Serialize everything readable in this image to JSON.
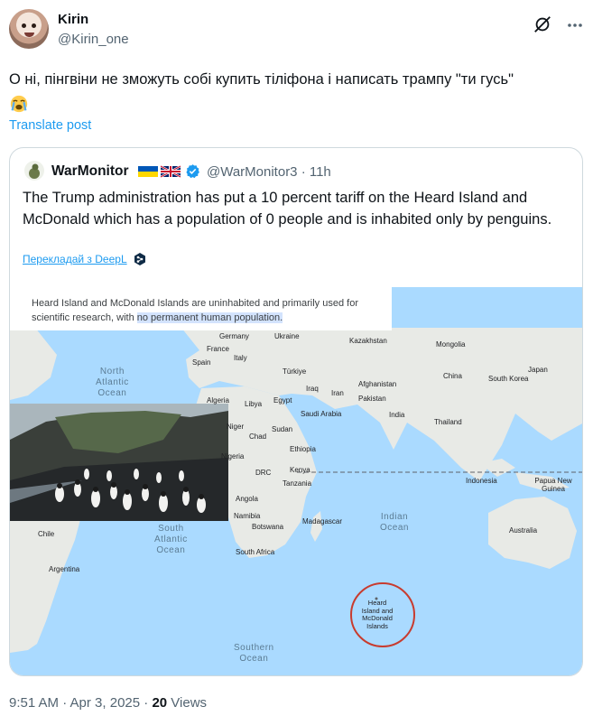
{
  "author": {
    "display_name": "Kirin",
    "handle": "@Kirin_one"
  },
  "post": {
    "text": "О ні, пінгвіни не зможуть собі купить тіліфона і написать трампу \"ти гусь\"",
    "emoji_icon": "loudly-crying-face-icon",
    "translate_label": "Translate post"
  },
  "quoted": {
    "display_name": "WarMonitor",
    "flags": [
      "ukraine-flag-icon",
      "uk-flag-icon"
    ],
    "handle": "@WarMonitor3",
    "time": "· 11h",
    "text": "The Trump administration has put a 10 percent tariff on the Heard Island and McDonald which has a population of 0 people and is inhabited only by penguins.",
    "translate_label": "Перекладай з DeepL",
    "image": {
      "search_text": "Heard Island and McDonald Islands are uninhabited and primarily used for scientific research, with ",
      "search_highlight": "no permanent human population.",
      "oceans": [
        "North\nAtlantic\nOcean",
        "South\nAtlantic\nOcean",
        "Indian\nOcean",
        "Southern\nOcean"
      ],
      "countries": [
        "Germany",
        "Ukraine",
        "Kazakhstan",
        "Mongolia",
        "France",
        "Spain",
        "Italy",
        "Türkiye",
        "China",
        "Japan",
        "South Korea",
        "Iraq",
        "Iran",
        "Afghanistan",
        "Pakistan",
        "Algeria",
        "Libya",
        "Egypt",
        "Saudi Arabia",
        "India",
        "Thailand",
        "Niger",
        "Chad",
        "Sudan",
        "Ethiopia",
        "Nigeria",
        "Kenya",
        "DRC",
        "Tanzania",
        "Angola",
        "Namibia",
        "Botswana",
        "Madagascar",
        "South Africa",
        "Indonesia",
        "Papua New Guinea",
        "Australia",
        "Chile",
        "Argentina"
      ],
      "marker_label": "Heard\nIsland and\nMcDonald\nIslands",
      "colors": {
        "land": "#e8eae6",
        "water": "#aadaff",
        "marker": "#c83b2e",
        "highlight": "#d3e3fd"
      }
    }
  },
  "meta": {
    "time": "9:51 AM · Apr 3, 2025 · ",
    "views_count": "20",
    "views_label": " Views"
  },
  "colors": {
    "link": "#1d9bf0",
    "muted": "#536471",
    "text": "#0f1419"
  }
}
